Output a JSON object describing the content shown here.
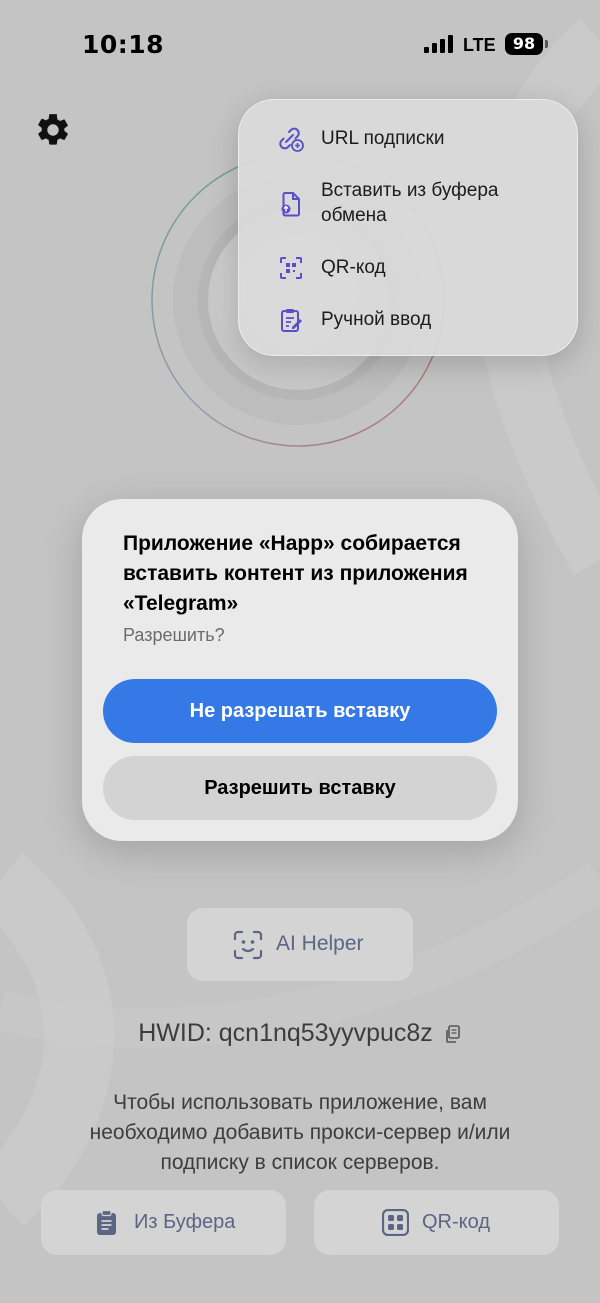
{
  "status_bar": {
    "time": "10:18",
    "network": "LTE",
    "battery": "98"
  },
  "add_menu": {
    "items": [
      {
        "label": "URL подписки",
        "icon": "link-plus-icon"
      },
      {
        "label": "Вставить из буфера обмена",
        "icon": "file-upload-icon"
      },
      {
        "label": "QR-код",
        "icon": "qr-scan-icon"
      },
      {
        "label": "Ручной ввод",
        "icon": "clipboard-edit-icon"
      }
    ]
  },
  "dialog": {
    "title": "Приложение «Happ» собирается вставить контент из приложения «Telegram»",
    "subtitle": "Разрешить?",
    "deny_label": "Не разрешать вставку",
    "allow_label": "Разрешить вставку"
  },
  "ai_helper": {
    "label": "AI Helper"
  },
  "hwid": {
    "text": "HWID: qcn1nq53yyvpuc8z"
  },
  "info": {
    "text": "Чтобы использовать приложение, вам необходимо добавить прокси-сервер и/или подписку в список серверов."
  },
  "bottom_buttons": {
    "clipboard_label": "Из Буфера",
    "qr_label": "QR-код"
  },
  "colors": {
    "accent": "#3579e6",
    "icon_purple": "#5b4fc9",
    "muted_button_text": "#5d6584"
  }
}
